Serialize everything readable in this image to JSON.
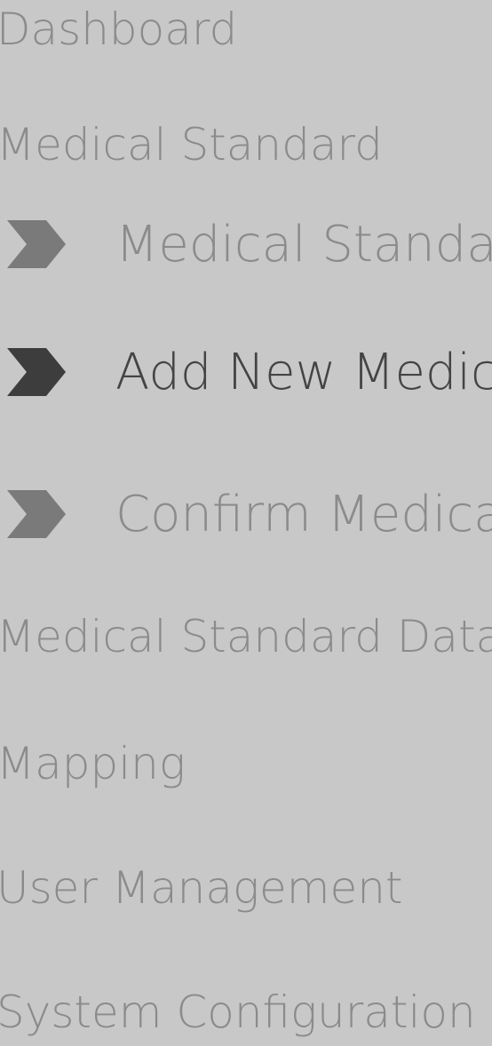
{
  "nav": {
    "dashboard": "Dashboard",
    "medical_standard": "Medical Standard",
    "sub_items": [
      {
        "label": "Medical Standard",
        "state": "inactive"
      },
      {
        "label": "Add New Medical",
        "state": "active"
      },
      {
        "label": "Confirm Medical S",
        "state": "inactive"
      }
    ],
    "medical_standard_data": "Medical Standard Data",
    "mapping": "Mapping",
    "user_management": "User Management",
    "system_configuration": "System Configuration"
  },
  "colors": {
    "background": "#c8c8c8",
    "text_inactive": "#8b8b8b",
    "text_active": "#444444",
    "chevron_inactive": "#7a7a7a",
    "chevron_active": "#3d3d3d"
  }
}
